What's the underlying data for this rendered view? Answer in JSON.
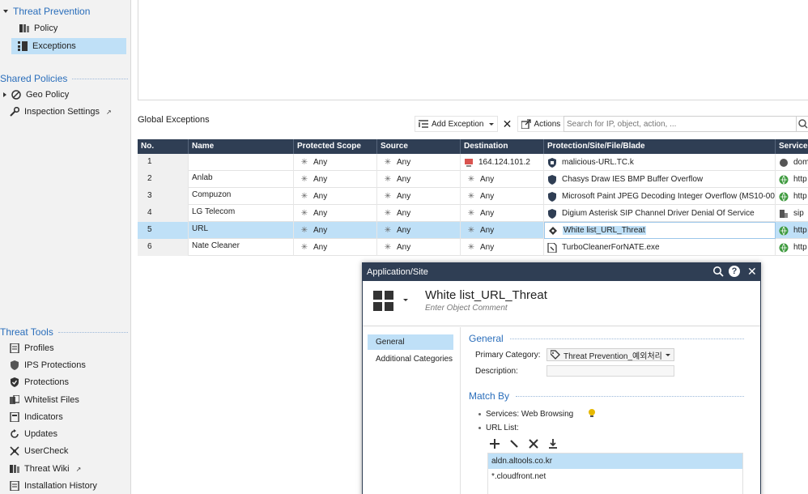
{
  "sidebar": {
    "threat_prevention": "Threat Prevention",
    "policy": "Policy",
    "exceptions": "Exceptions",
    "shared_policies": "Shared Policies",
    "geo_policy": "Geo Policy",
    "inspection_settings": "Inspection Settings",
    "threat_tools": "Threat Tools",
    "tools": [
      "Profiles",
      "IPS Protections",
      "Protections",
      "Whitelist Files",
      "Indicators",
      "Updates",
      "UserCheck",
      "Threat Wiki",
      "Installation History"
    ]
  },
  "main": {
    "title": "Global Exceptions",
    "add_exception": "Add Exception",
    "actions": "Actions",
    "search_placeholder": "Search for IP, object, action, ..."
  },
  "table": {
    "headers": [
      "No.",
      "Name",
      "Protected Scope",
      "Source",
      "Destination",
      "Protection/Site/File/Blade",
      "Services"
    ],
    "rows": [
      {
        "no": "1",
        "name": "",
        "scope": "Any",
        "source": "Any",
        "dest": "164.124.101.2",
        "protection": "malicious-URL.TC.k",
        "service": "dom"
      },
      {
        "no": "2",
        "name": "Anlab",
        "scope": "Any",
        "source": "Any",
        "dest": "Any",
        "protection": "Chasys Draw IES BMP Buffer Overflow",
        "service": "http"
      },
      {
        "no": "3",
        "name": "Compuzon",
        "scope": "Any",
        "source": "Any",
        "dest": "Any",
        "protection": "Microsoft Paint JPEG Decoding Integer Overflow (MS10-005)",
        "service": "http"
      },
      {
        "no": "4",
        "name": "LG Telecom",
        "scope": "Any",
        "source": "Any",
        "dest": "Any",
        "protection": "Digium Asterisk SIP Channel Driver Denial Of Service",
        "service": "sip"
      },
      {
        "no": "5",
        "name": "URL",
        "scope": "Any",
        "source": "Any",
        "dest": "Any",
        "protection": "White list_URL_Threat",
        "service": "http"
      },
      {
        "no": "6",
        "name": "Nate Cleaner",
        "scope": "Any",
        "source": "Any",
        "dest": "Any",
        "protection": "TurboCleanerForNATE.exe",
        "service": "http"
      }
    ]
  },
  "dialog": {
    "title": "Application/Site",
    "object_name": "White list_URL_Threat",
    "comment_placeholder": "Enter Object Comment",
    "nav": [
      "General",
      "Additional Categories"
    ],
    "general_header": "General",
    "primary_category_label": "Primary Category:",
    "primary_category_value": "Threat Prevention_예외처리",
    "description_label": "Description:",
    "match_by_header": "Match By",
    "services_text": "Services: Web Browsing",
    "url_list_label": "URL List:",
    "urls": [
      "aldn.altools.co.kr",
      "*.cloudfront.net"
    ]
  },
  "colors": {
    "header_bg": "#2f3e54",
    "selection": "#bfe0f7",
    "section_blue": "#2a6ebb"
  }
}
